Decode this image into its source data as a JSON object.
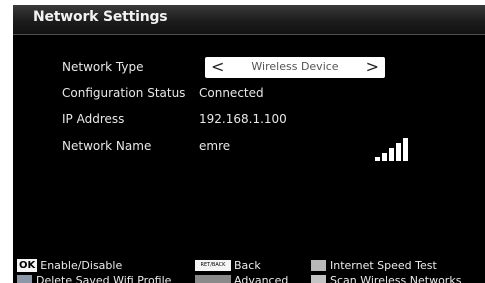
{
  "window": {
    "title": "Network Settings"
  },
  "settings": {
    "network_type": {
      "label": "Network Type",
      "value": "Wireless Device",
      "prev_arrow": "<",
      "next_arrow": ">"
    },
    "configuration_status": {
      "label": "Configuration Status",
      "value": "Connected"
    },
    "ip_address": {
      "label": "IP Address",
      "value": "192.168.1.100"
    },
    "network_name": {
      "label": "Network Name",
      "value": "emre",
      "signal_strength": "5 of 5",
      "signal_icon": "wifi-signal-bars-icon"
    }
  },
  "footer": {
    "ok": {
      "key": "OK",
      "label": "Enable/Disable"
    },
    "back": {
      "key": "RET/BACK",
      "label": "Back"
    },
    "speed_test": {
      "label": "Internet Speed Test",
      "key_color": "#b9b9b9"
    },
    "delete_profile": {
      "label": "Delete Saved Wifi Profile",
      "key_color": "#8c97a8"
    },
    "advanced": {
      "label": "Advanced",
      "key_color": "#8a8a8a"
    },
    "scan": {
      "label": "Scan Wireless Networks",
      "key_color": "#c4c4c4"
    }
  },
  "colors": {
    "background": "#000000",
    "text": "#e8e8e8",
    "selector_bg": "#ffffff"
  }
}
